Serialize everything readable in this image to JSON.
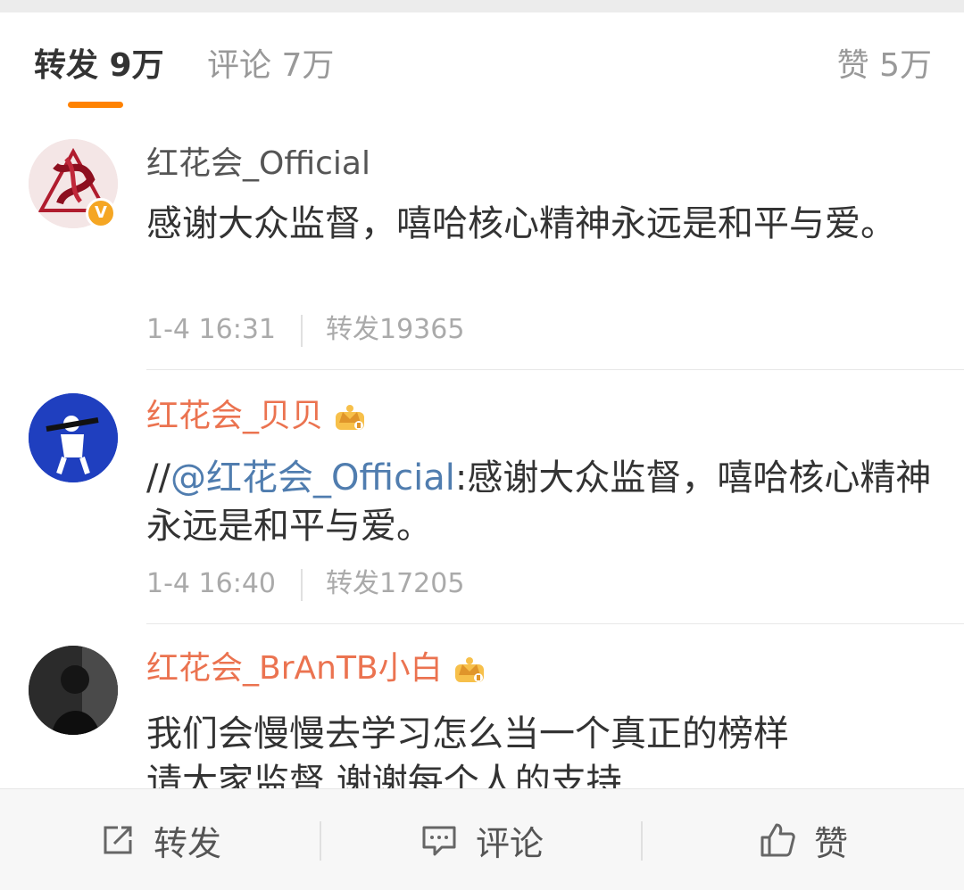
{
  "tabs": {
    "repost": "转发 9万",
    "comment": "评论 7万",
    "like": "赞 5万"
  },
  "reposts": [
    {
      "username": "红花会_Official",
      "content": "感谢大众监督，嘻哈核心精神永远是和平与爱。",
      "time": "1-4 16:31",
      "repost_count": "转发19365"
    },
    {
      "username": "红花会_贝贝",
      "prefix": "//",
      "mention": "@红花会_Official",
      "content": ":感谢大众监督，嘻哈核心精神永远是和平与爱。",
      "time": "1-4 16:40",
      "repost_count": "转发17205"
    },
    {
      "username": "红花会_BrAnTB小白",
      "content_line1": "我们会慢慢去学习怎么当一个真正的榜样",
      "content_line2": "请大家监督 谢谢每个人的支持"
    }
  ],
  "bottom_bar": {
    "repost": "转发",
    "comment": "评论",
    "like": "赞"
  },
  "colors": {
    "accent": "#ff8200",
    "vip_name": "#eb7350",
    "mention": "#507daf"
  },
  "icons": [
    "verified-v-icon",
    "crown-badge-icon",
    "share-icon",
    "comment-icon",
    "thumbs-up-icon"
  ]
}
